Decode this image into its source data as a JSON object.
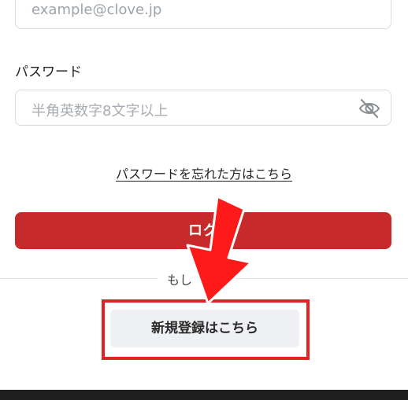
{
  "form": {
    "email_value": "example@clove.jp",
    "password_label": "パスワード",
    "password_placeholder": "半角英数字8文字以上",
    "forgot_link": "パスワードを忘れた方はこちら",
    "login_button": "ログ",
    "divider_text": "もし",
    "register_button": "新規登録はこちら"
  },
  "icons": {
    "password_toggle": "eye-slash-icon",
    "annotation_arrow": "arrow-down-icon"
  },
  "colors": {
    "primary": "#c62a2a",
    "annotation": "#e32222",
    "register_bg": "#eef0f3"
  }
}
